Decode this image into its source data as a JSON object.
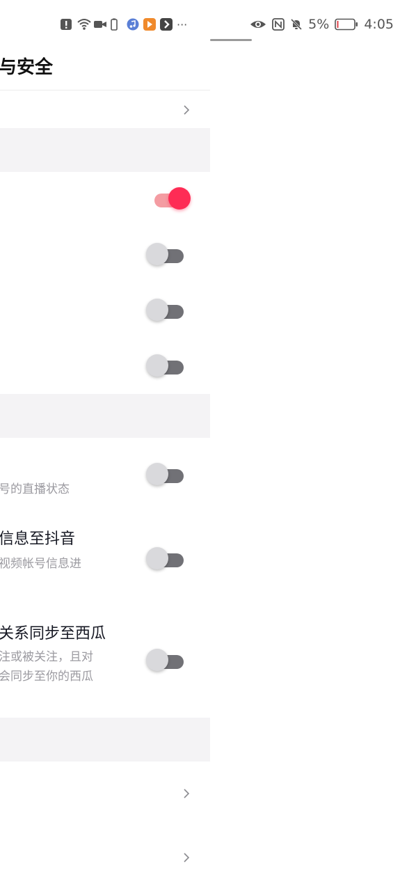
{
  "status_bar": {
    "left_icons": [
      "alert-icon",
      "wifi-icon",
      "video-icon",
      "battery-small-icon",
      "music-app-icon",
      "orange-app-icon",
      "dark-app-icon",
      "more-icon"
    ],
    "more_glyph": "···",
    "right_icons": [
      "eye-icon",
      "nfc-icon",
      "mute-bell-icon"
    ],
    "battery_percent": "5%",
    "time": "4:05"
  },
  "page": {
    "title": "与安全",
    "sections": [
      {
        "type": "nav-row",
        "icon": "chevron-right-icon"
      },
      {
        "type": "toggle-row",
        "state": "on"
      },
      {
        "type": "toggle-row",
        "state": "off"
      },
      {
        "type": "toggle-row",
        "state": "off"
      },
      {
        "type": "toggle-row",
        "state": "off"
      }
    ],
    "sync_items": [
      {
        "title": "",
        "desc": "号的直播状态",
        "state": "off"
      },
      {
        "title": "信息至抖音",
        "desc": "视频帐号信息进",
        "state": "off"
      },
      {
        "title": "关系同步至西瓜",
        "desc_lines": [
          "注或被关注，且对",
          "会同步至你的西瓜"
        ],
        "state": "off"
      }
    ],
    "bottom_rows": [
      {
        "icon": "chevron-right-icon"
      },
      {
        "icon": "chevron-right-icon"
      }
    ]
  },
  "colors": {
    "accent": "#fe2c55",
    "toggle_off_track": "#717176",
    "section_bg": "#f4f3f5",
    "secondary_text": "#9b9aa0"
  }
}
